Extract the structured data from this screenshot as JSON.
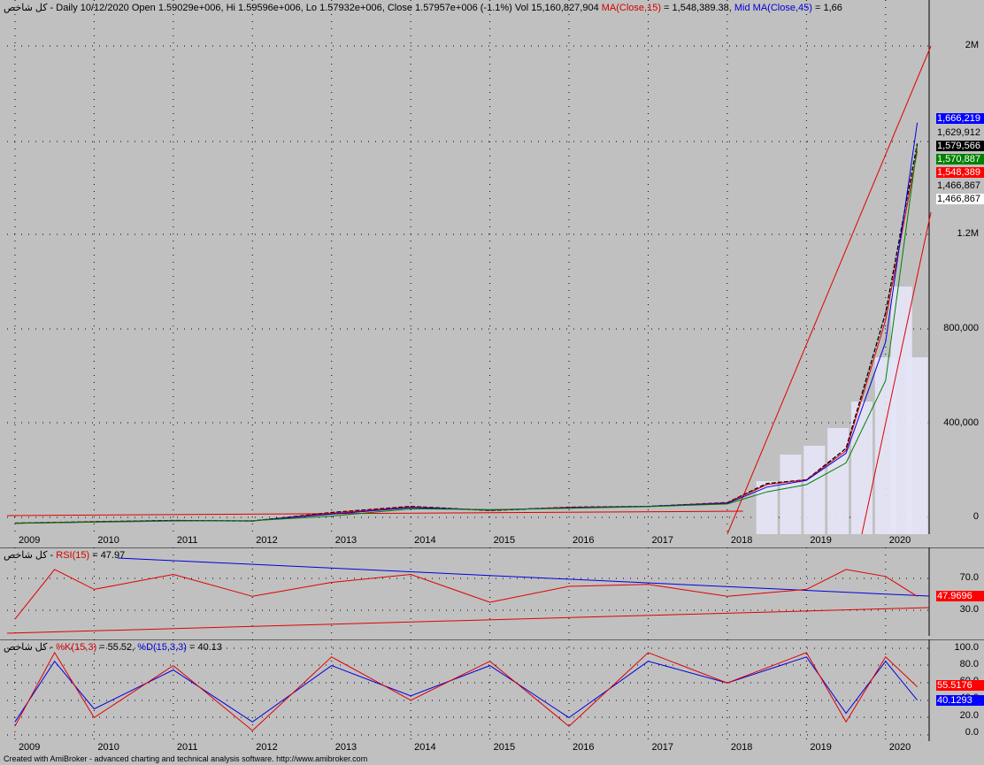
{
  "main": {
    "header_prefix": "کل شاخص - Daily 10/12/2020 Open 1.59029e+006, Hi 1.59596e+006, Lo 1.57932e+006, Close 1.57957e+006 (-1.1%) Vol 15,160,827,904 ",
    "ma15_label": "MA(Close,15)",
    "ma15_value": " = 1,548,389.38, ",
    "mid_label": "Mid ",
    "ma45_label": "MA(Close,45)",
    "ma45_value": " = 1,66",
    "y_ticks": [
      "2M",
      "1.2M",
      "800,000",
      "400,000",
      "0"
    ],
    "tags": [
      {
        "text": "1,666,219",
        "bg": "#0000ff",
        "fg": "#ffffff"
      },
      {
        "text": "1,629,912",
        "bg": "#c0c0c0",
        "fg": "#000000"
      },
      {
        "text": "1,579,566",
        "bg": "#000000",
        "fg": "#ffffff"
      },
      {
        "text": "1,570,887",
        "bg": "#008000",
        "fg": "#ffffff"
      },
      {
        "text": "1,548,389",
        "bg": "#ff0000",
        "fg": "#ffffff"
      },
      {
        "text": "1,466,867",
        "bg": "#c0c0c0",
        "fg": "#000000"
      },
      {
        "text": "1,466,867",
        "bg": "#ffffff",
        "fg": "#000000"
      }
    ]
  },
  "x_labels": [
    "2009",
    "2010",
    "2011",
    "2012",
    "2013",
    "2014",
    "2015",
    "2016",
    "2017",
    "2018",
    "2019",
    "2020"
  ],
  "rsi": {
    "header_prefix": "کل شاخص - ",
    "label": "RSI(15)",
    "value": " = 47.97",
    "y_ticks": [
      "70.0",
      "30.0"
    ],
    "tag": {
      "text": "47.9696",
      "bg": "#ff0000",
      "fg": "#ffffff"
    }
  },
  "stoch": {
    "header_prefix": "کل شاخص - ",
    "k_label": "%K(15,3)",
    "k_value": " = 55.52, ",
    "d_label": "%D(15,3,3)",
    "d_value": " = 40.13",
    "y_ticks": [
      "100.0",
      "80.0",
      "60.0",
      "40.0",
      "20.0",
      "0.0"
    ],
    "tag_k": {
      "text": "55.5176",
      "bg": "#ff0000",
      "fg": "#ffffff"
    },
    "tag_d": {
      "text": "40.1293",
      "bg": "#0000ff",
      "fg": "#ffffff"
    }
  },
  "footer": "Created with AmiBroker - advanced charting and technical analysis software. http://www.amibroker.com",
  "chart_data": [
    {
      "type": "line",
      "x_unit": "year",
      "x": [
        2009,
        2010,
        2011,
        2012,
        2013,
        2014,
        2015,
        2016,
        2017,
        2018,
        2018.5,
        2019,
        2019.5,
        2020,
        2020.4
      ],
      "series": [
        {
          "name": "Close",
          "values": [
            11000,
            17000,
            22000,
            20000,
            55000,
            80000,
            63000,
            77000,
            80000,
            96000,
            175000,
            190000,
            320000,
            880000,
            1579566
          ]
        },
        {
          "name": "MA(Close,15)",
          "values": [
            11000,
            16500,
            21500,
            20000,
            52000,
            78000,
            64000,
            76000,
            80000,
            95000,
            170000,
            190000,
            310000,
            850000,
            1548389
          ]
        },
        {
          "name": "MA(Close,45)",
          "values": [
            10500,
            16000,
            21000,
            20500,
            48000,
            75000,
            66000,
            74000,
            80000,
            93000,
            160000,
            188000,
            300000,
            760000,
            1666219
          ]
        }
      ],
      "ylim": [
        -20000,
        2100000
      ]
    },
    {
      "type": "line",
      "x_unit": "year",
      "x": [
        2009,
        2009.5,
        2010,
        2011,
        2012,
        2013,
        2014,
        2015,
        2016,
        2017,
        2018,
        2019,
        2019.5,
        2020,
        2020.4
      ],
      "series": [
        {
          "name": "RSI(15)",
          "values": [
            25,
            75,
            55,
            70,
            48,
            62,
            70,
            42,
            58,
            60,
            48,
            55,
            75,
            68,
            47.97
          ]
        }
      ],
      "ylim": [
        10,
        90
      ]
    },
    {
      "type": "line",
      "x_unit": "year",
      "x": [
        2009,
        2009.5,
        2010,
        2011,
        2012,
        2013,
        2014,
        2015,
        2016,
        2017,
        2018,
        2019,
        2019.5,
        2020,
        2020.4
      ],
      "series": [
        {
          "name": "%K(15,3)",
          "values": [
            10,
            95,
            20,
            80,
            5,
            90,
            40,
            85,
            10,
            95,
            60,
            95,
            15,
            90,
            55.52
          ]
        },
        {
          "name": "%D(15,3,3)",
          "values": [
            15,
            85,
            30,
            75,
            15,
            80,
            45,
            80,
            20,
            85,
            60,
            90,
            25,
            85,
            40.13
          ]
        }
      ],
      "ylim": [
        0,
        100
      ]
    }
  ]
}
